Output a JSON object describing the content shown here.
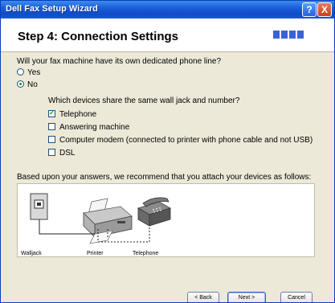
{
  "window": {
    "title": "Dell Fax Setup Wizard"
  },
  "titlebar": {
    "help_label": "?",
    "close_label": "X"
  },
  "header": {
    "step_title": "Step 4: Connection Settings",
    "progress": {
      "completed_steps": 4,
      "total_steps": 4
    }
  },
  "question1": {
    "text": "Will your fax machine have its own dedicated phone line?",
    "options": [
      {
        "label": "Yes",
        "selected": false
      },
      {
        "label": "No",
        "selected": true
      }
    ]
  },
  "question2": {
    "text": "Which devices share the same wall jack and number?",
    "devices": [
      {
        "label": "Telephone",
        "checked": true
      },
      {
        "label": "Answering machine",
        "checked": false
      },
      {
        "label": "Computer modem (connected to printer with phone cable and not USB)",
        "checked": false
      },
      {
        "label": "DSL",
        "checked": false
      }
    ]
  },
  "recommendation": {
    "text": "Based upon your answers, we recommend that you attach your devices as follows:"
  },
  "diagram": {
    "labels": {
      "walljack": "Walljack",
      "printer": "Printer",
      "telephone": "Telephone"
    }
  },
  "buttons": {
    "back": "< Back",
    "next": "Next >",
    "cancel": "Cancel"
  },
  "colors": {
    "titlebar": "#1a5fd8",
    "dialog_bg": "#ece9d8",
    "progress_blue": "#3a62d8"
  }
}
